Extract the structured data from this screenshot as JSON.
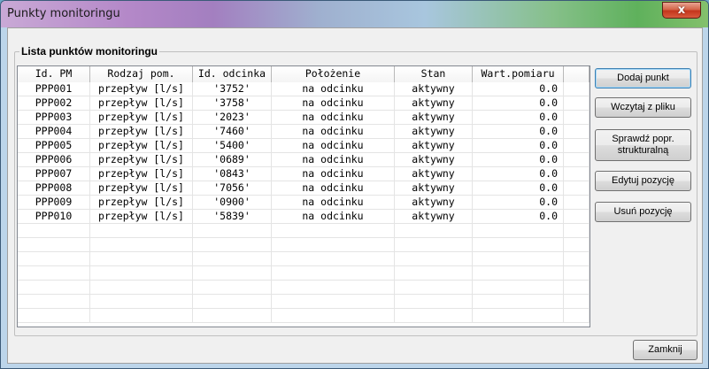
{
  "window": {
    "title": "Punkty monitoringu",
    "close_glyph": "x"
  },
  "group": {
    "label": "Lista punktów monitoringu"
  },
  "table": {
    "columns": [
      "Id. PM",
      "Rodzaj pom.",
      "Id. odcinka",
      "Położenie",
      "Stan",
      "Wart.pomiaru",
      ""
    ],
    "rows": [
      [
        "PPP001",
        "przepływ [l/s]",
        "'3752'",
        "na odcinku",
        "aktywny",
        "0.0"
      ],
      [
        "PPP002",
        "przepływ [l/s]",
        "'3758'",
        "na odcinku",
        "aktywny",
        "0.0"
      ],
      [
        "PPP003",
        "przepływ [l/s]",
        "'2023'",
        "na odcinku",
        "aktywny",
        "0.0"
      ],
      [
        "PPP004",
        "przepływ [l/s]",
        "'7460'",
        "na odcinku",
        "aktywny",
        "0.0"
      ],
      [
        "PPP005",
        "przepływ [l/s]",
        "'5400'",
        "na odcinku",
        "aktywny",
        "0.0"
      ],
      [
        "PPP006",
        "przepływ [l/s]",
        "'0689'",
        "na odcinku",
        "aktywny",
        "0.0"
      ],
      [
        "PPP007",
        "przepływ [l/s]",
        "'0843'",
        "na odcinku",
        "aktywny",
        "0.0"
      ],
      [
        "PPP008",
        "przepływ [l/s]",
        "'7056'",
        "na odcinku",
        "aktywny",
        "0.0"
      ],
      [
        "PPP009",
        "przepływ [l/s]",
        "'0900'",
        "na odcinku",
        "aktywny",
        "0.0"
      ],
      [
        "PPP010",
        "przepływ [l/s]",
        "'5839'",
        "na odcinku",
        "aktywny",
        "0.0"
      ]
    ],
    "empty_rows": 7
  },
  "buttons": {
    "add_point": "Dodaj punkt",
    "load_file": "Wczytaj z pliku",
    "check_structural": "Sprawdź popr. strukturalną",
    "edit_item": "Edytuj pozycję",
    "delete_item": "Usuń pozycję",
    "close": "Zamknij"
  },
  "icons": {
    "close": "close-icon"
  },
  "colors": {
    "close_button": "#c4361c",
    "default_button_border": "#3c7fb1"
  }
}
